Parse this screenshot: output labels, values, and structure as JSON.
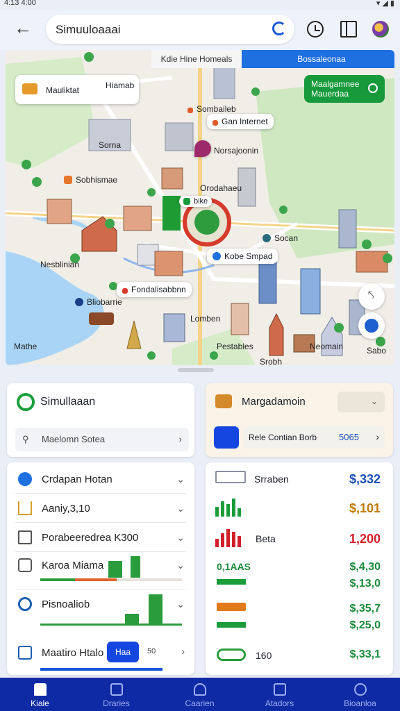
{
  "status": {
    "time": "4:13 4:00"
  },
  "header": {
    "search_value": "Simuuloaaai",
    "icons": [
      "back-arrow-icon",
      "mic-icon",
      "history-icon",
      "book-icon",
      "avatar"
    ]
  },
  "map": {
    "tabs": [
      "Kdie Hine Homeals",
      "Bossaleonaa"
    ],
    "labels": {
      "top_chip": "Mauliktat",
      "top_chip_2": "Hiamab",
      "somb": "Sombaileb",
      "sorna": "Sorna",
      "sobh": "Sobhismae",
      "pin_title": "Norsajoonin",
      "orodan": "Orodahaeu",
      "bike": "bike",
      "green_title": "Maalgamnee",
      "green_sub": "Mauerdaa",
      "kobe": "Kobe Smpad",
      "socan": "Socan",
      "fonda": "Fondalisabbnn",
      "bliobe": "Bliobarrie",
      "nesblinian": "Nesblinian",
      "lomban": "Lomben",
      "mathe": "Mathe",
      "sooh": "Srobh",
      "pestables": "Pestables",
      "neomain": "Neomain",
      "sabo": "Sabo",
      "gan_internet": "Gan Internet"
    }
  },
  "left_top": {
    "title": "Simullaaan",
    "field": "Maelomn Sotea"
  },
  "right_top": {
    "title": "Margadamoin",
    "field": "Rele Contian Borb",
    "field_value": "5065"
  },
  "left_list": [
    {
      "label": "Crdapan Hotan"
    },
    {
      "label": "Aaniy,3,10"
    },
    {
      "label": "Porabeeredrea K300"
    },
    {
      "label": "Karoa Miama"
    },
    {
      "label": "Pisnoaliob"
    }
  ],
  "left_footer": {
    "label": "Maatiro Htalo",
    "button": "Haa",
    "value": "50"
  },
  "right_list": [
    {
      "label": "Srraben",
      "value": "$,332",
      "color": "#1a4fb8"
    },
    {
      "label": "",
      "value": "$,101",
      "color": "#c07a00"
    },
    {
      "label": "Beta",
      "value": "1,200",
      "color": "#d21f2a"
    },
    {
      "label": "0,1AAS",
      "value": "$,4,30",
      "color": "#1a8a3a"
    },
    {
      "label": "",
      "value": "$,13,0",
      "color": "#1a8a3a"
    },
    {
      "label": "",
      "value": "$,35,7",
      "color": "#1a8a3a"
    },
    {
      "label": "",
      "value": "$,25,0",
      "color": "#1a8a3a"
    },
    {
      "label": "160",
      "value": "$,33,1",
      "color": "#1a8a3a"
    }
  ],
  "nav": [
    {
      "label": "Kiale"
    },
    {
      "label": "Draries"
    },
    {
      "label": "Caarien"
    },
    {
      "label": "Atadors"
    },
    {
      "label": "Bioanloa"
    }
  ],
  "colors": {
    "accent": "#1e6fe0",
    "nav_bg": "#0f2aa5",
    "green": "#179a3b"
  }
}
